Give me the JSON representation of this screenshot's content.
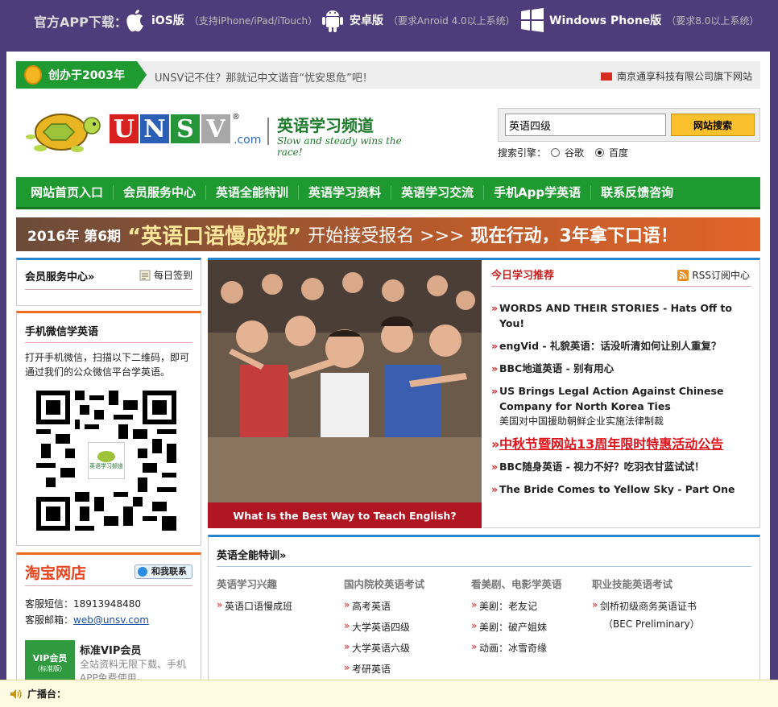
{
  "topbar": {
    "title": "官方APP下载：",
    "ios": {
      "name": "iOS版",
      "note": "（支持iPhone/iPad/iTouch）"
    },
    "android": {
      "name": "安卓版",
      "note": "（要求Anroid 4.0以上系统）"
    },
    "winphone": {
      "name": "Windows Phone版",
      "note": "（要求8.0以上系统）"
    }
  },
  "slogan": {
    "since": "创办于2003年",
    "text": "UNSV记不住？那就记中文谐音“忧安思危”吧！",
    "company": "南京通享科技有限公司旗下网站"
  },
  "logo": {
    "letters": [
      "U",
      "N",
      "S",
      "V"
    ],
    "letter_colors": [
      "#d8201e",
      "#2a5fb5",
      "#26953a",
      "#a8a8a8"
    ],
    "reg": "®",
    "dotcom": ".com",
    "channel": "英语学习频道",
    "motto": "Slow and steady wins the race!"
  },
  "search": {
    "value": "英语四级",
    "button": "网站搜索",
    "engine_label": "搜索引擎：",
    "engines": [
      "谷歌",
      "百度"
    ],
    "selected": "百度"
  },
  "nav": [
    "网站首页入口",
    "会员服务中心",
    "英语全能特训",
    "英语学习资料",
    "英语学习交流",
    "手机App学英语",
    "联系反馈咨询"
  ],
  "banner": {
    "year": "2016年 第6期",
    "name": "“英语口语慢成班”",
    "mid": "开始接受报名 >>>",
    "cta": "现在行动，3年拿下口语！"
  },
  "member": {
    "title": "会员服务中心»",
    "checkin": "每日签到"
  },
  "wechat": {
    "title": "手机微信学英语",
    "desc": "打开手机微信，扫描以下二维码，即可通过我们的公众微信平台学英语。",
    "qr_logo_text": "英语学习频道"
  },
  "taobao": {
    "brand": "淘宝网店",
    "contact": "和我联系",
    "sms": "客服短信：18913948480",
    "email_label": "客服邮箱：",
    "email": "web@unsv.com",
    "vip_title": "标准VIP会员",
    "vip_badge": "VIP会员",
    "vip_badge_sub": "（标准版）",
    "vip_desc": "全站资料无限下载、手机APP免费使用。"
  },
  "photo": {
    "caption": "What Is the Best Way to Teach English?"
  },
  "recommend": {
    "title": "今日学习推荐",
    "rss": "RSS订阅中心",
    "items": [
      {
        "text": "WORDS AND THEIR STORIES - Hats Off to You!"
      },
      {
        "text": "engVid - 礼貌英语：话没听清如何让别人重复？"
      },
      {
        "text": "BBC地道英语 - 别有用心"
      },
      {
        "text": "US Brings Legal Action Against Chinese Company for North Korea Ties",
        "sub": "美国对中国援助朝鲜企业实施法律制裁"
      },
      {
        "text": "中秋节暨网站13周年限时特惠活动公告",
        "hot": true
      },
      {
        "text": "BBC随身英语 - 视力不好？吃羽衣甘蓝试试！"
      },
      {
        "text": "The Bride Comes to Yellow Sky - Part One"
      }
    ]
  },
  "training": {
    "title": "英语全能特训»",
    "cols": [
      {
        "head": "英语学习兴趣",
        "items": [
          "英语口语慢成班"
        ]
      },
      {
        "head": "国内院校英语考试",
        "items": [
          "高考英语",
          "大学英语四级",
          "大学英语六级",
          "考研英语"
        ]
      },
      {
        "head": "看美剧、电影学英语",
        "items": [
          "美剧：老友记",
          "美剧：破产姐妹",
          "动画：冰雪奇缘"
        ]
      },
      {
        "head": "职业技能英语考试",
        "items": [
          "剑桥初级商务英语证书",
          "（BEC Preliminary）"
        ]
      }
    ]
  },
  "broadcast": {
    "label": "广播台："
  }
}
